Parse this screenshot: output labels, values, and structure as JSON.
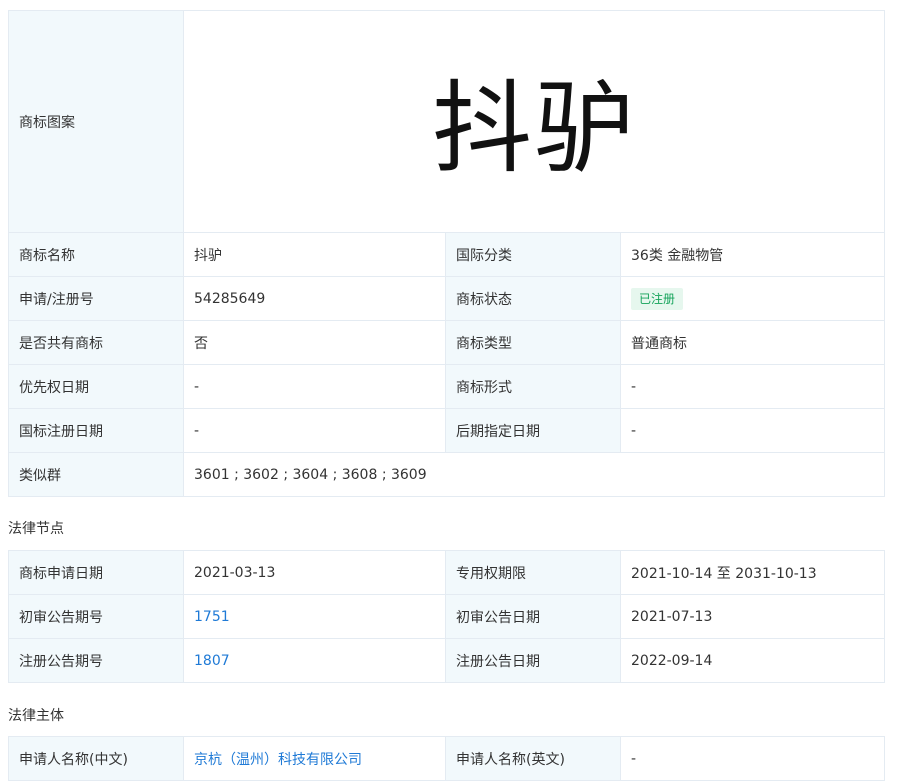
{
  "info": {
    "labels": {
      "image": "商标图案",
      "name": "商标名称",
      "intl_class": "国际分类",
      "reg_no": "申请/注册号",
      "status": "商标状态",
      "shared": "是否共有商标",
      "type": "商标类型",
      "priority_date": "优先权日期",
      "form": "商标形式",
      "intl_reg_date": "国标注册日期",
      "later_designation_date": "后期指定日期",
      "similar_groups": "类似群"
    },
    "values": {
      "logo_text": "抖驴",
      "name": "抖驴",
      "intl_class": "36类 金融物管",
      "reg_no": "54285649",
      "status": "已注册",
      "shared": "否",
      "type": "普通商标",
      "priority_date": "-",
      "form": "-",
      "intl_reg_date": "-",
      "later_designation_date": "-",
      "similar_groups": "3601 ; 3602 ; 3604 ; 3608 ; 3609"
    }
  },
  "legal_nodes": {
    "title": "法律节点",
    "labels": {
      "apply_date": "商标申请日期",
      "exclusive_period": "专用权期限",
      "prelim_issue_no": "初审公告期号",
      "prelim_date": "初审公告日期",
      "reg_issue_no": "注册公告期号",
      "reg_date": "注册公告日期"
    },
    "values": {
      "apply_date": "2021-03-13",
      "exclusive_period": "2021-10-14 至 2031-10-13",
      "prelim_issue_no": "1751",
      "prelim_date": "2021-07-13",
      "reg_issue_no": "1807",
      "reg_date": "2022-09-14"
    }
  },
  "legal_subject": {
    "title": "法律主体",
    "labels": {
      "applicant_cn": "申请人名称(中文)",
      "applicant_en": "申请人名称(英文)"
    },
    "values": {
      "applicant_cn": "京杭（温州）科技有限公司",
      "applicant_en": "-"
    }
  },
  "colors": {
    "label_bg": "#f2f9fc",
    "border": "#e4ebf2",
    "link": "#1f7ad6",
    "badge_bg": "#e6f7ee",
    "badge_text": "#14a35a"
  }
}
